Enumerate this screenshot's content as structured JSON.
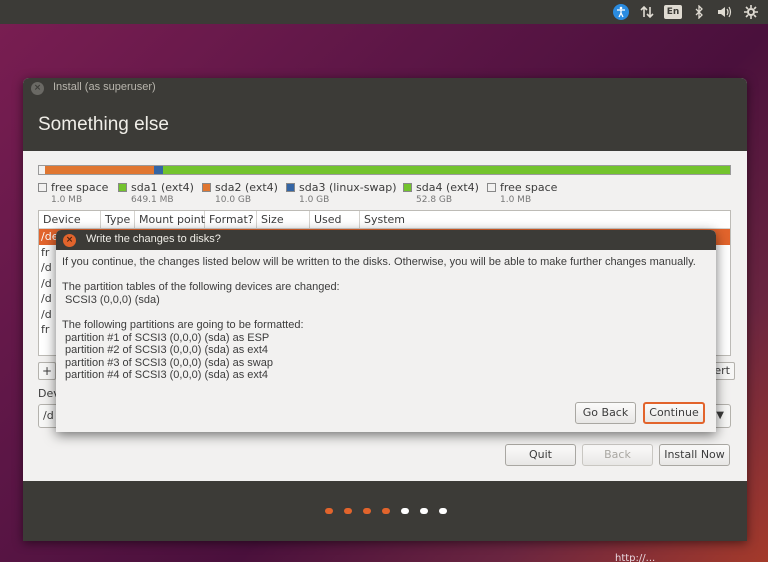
{
  "topbar": {
    "icons": [
      "accessibility-icon",
      "network-icon",
      "keyboard-language-icon",
      "bluetooth-icon",
      "volume-icon",
      "settings-gear-icon"
    ],
    "language": "En"
  },
  "window": {
    "title": "Install (as superuser)",
    "heading": "Something else"
  },
  "legend": [
    {
      "name": "free space",
      "size": "1.0 MB",
      "color": "#f2f1f0"
    },
    {
      "name": "sda1 (ext4)",
      "size": "649.1 MB",
      "color": "#73c32d"
    },
    {
      "name": "sda2 (ext4)",
      "size": "10.0 GB",
      "color": "#e07630"
    },
    {
      "name": "sda3 (linux-swap)",
      "size": "1.0 GB",
      "color": "#3465a4"
    },
    {
      "name": "sda4 (ext4)",
      "size": "52.8 GB",
      "color": "#73c32d"
    },
    {
      "name": "free space",
      "size": "1.0 MB",
      "color": "#f2f1f0"
    }
  ],
  "table": {
    "headers": [
      "Device",
      "Type",
      "Mount point",
      "Format?",
      "Size",
      "Used",
      "System"
    ],
    "rows": [
      "/de",
      "fr",
      "/d",
      "/d",
      "/d",
      "/d",
      "fr"
    ]
  },
  "tools": {
    "add": "+",
    "revert": "ert"
  },
  "device_label": "Dev",
  "device_value": "/d",
  "buttons": {
    "quit": "Quit",
    "back": "Back",
    "install_now": "Install Now"
  },
  "progress_dots": {
    "done": 4,
    "total": 7,
    "done_color": "#e2642c",
    "pending_color": "#ffffff"
  },
  "dialog": {
    "title": "Write the changes to disks?",
    "intro": "If you continue, the changes listed below will be written to the disks. Otherwise, you will be able to make further changes manually.",
    "tables_heading": "The partition tables of the following devices are changed:",
    "tables_devices": [
      " SCSI3 (0,0,0) (sda)"
    ],
    "format_heading": "The following partitions are going to be formatted:",
    "format_items": [
      " partition #1 of SCSI3 (0,0,0) (sda) as ESP",
      " partition #2 of SCSI3 (0,0,0) (sda) as ext4",
      " partition #3 of SCSI3 (0,0,0) (sda) as swap",
      " partition #4 of SCSI3 (0,0,0) (sda) as ext4"
    ],
    "go_back": "Go Back",
    "continue": "Continue"
  },
  "watermark": "http://..."
}
